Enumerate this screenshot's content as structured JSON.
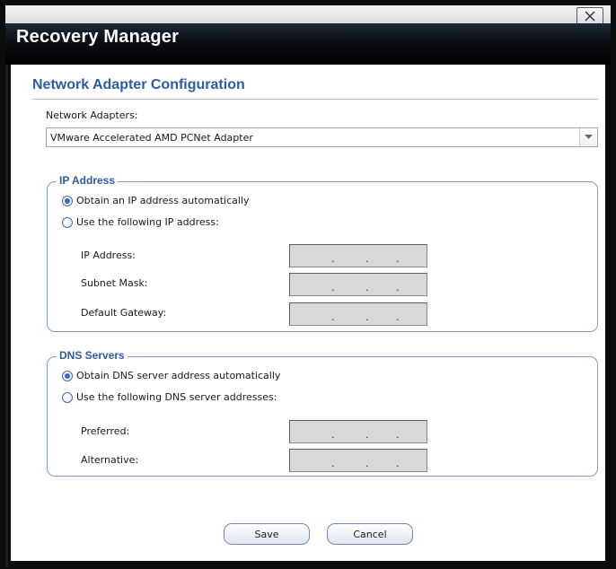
{
  "window": {
    "app_title": "Recovery Manager",
    "close_icon": "close-icon"
  },
  "config": {
    "section_title": "Network Adapter Configuration",
    "adapters_label": "Network Adapters:",
    "adapter_selected": "VMware Accelerated AMD PCNet Adapter"
  },
  "ip": {
    "group_title": "IP Address",
    "option_auto": "Obtain an IP address automatically",
    "option_manual": "Use the following IP address:",
    "auto_selected": true,
    "fields": [
      {
        "label": "IP Address:",
        "value": ". . ."
      },
      {
        "label": "Subnet Mask:",
        "value": ". . ."
      },
      {
        "label": "Default Gateway:",
        "value": ". . ."
      }
    ]
  },
  "dns": {
    "group_title": "DNS Servers",
    "option_auto": "Obtain DNS server address automatically",
    "option_manual": "Use the following DNS server addresses:",
    "auto_selected": true,
    "fields": [
      {
        "label": "Preferred:",
        "value": ". . ."
      },
      {
        "label": "Alternative:",
        "value": ". . ."
      }
    ]
  },
  "buttons": {
    "save": "Save",
    "cancel": "Cancel"
  },
  "colors": {
    "accent": "#2f5aa6",
    "group_border": "#7f9fc7",
    "field_bg": "#d9d9d9"
  }
}
